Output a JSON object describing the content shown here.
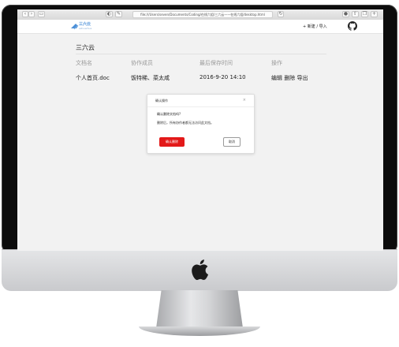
{
  "browser": {
    "url": "file:///Users/seven/Documents/Coding/在线六组/三六云——在线六组/desktop.html"
  },
  "header": {
    "logo_text": "三六云",
    "logo_sub": "ezhuazhua",
    "new_import": "+ 新建 / 导入"
  },
  "page": {
    "title": "三六云",
    "columns": [
      "文档名",
      "协作成员",
      "最后保存时间",
      "操作"
    ],
    "rows": [
      {
        "name": "个人首页.doc",
        "members": "饭特稀、菜太咸",
        "saved": "2016-9-20 14:10",
        "actions": "编辑 删除 导出"
      }
    ]
  },
  "dialog": {
    "title": "确认操作",
    "close": "×",
    "question": "确认删除文档吗?",
    "message": "删除后，所有协作者都无法访问此文档。",
    "confirm_label": "确认删除",
    "cancel_label": "取消"
  },
  "colors": {
    "accent": "#4a8fd8",
    "danger": "#e31919"
  }
}
